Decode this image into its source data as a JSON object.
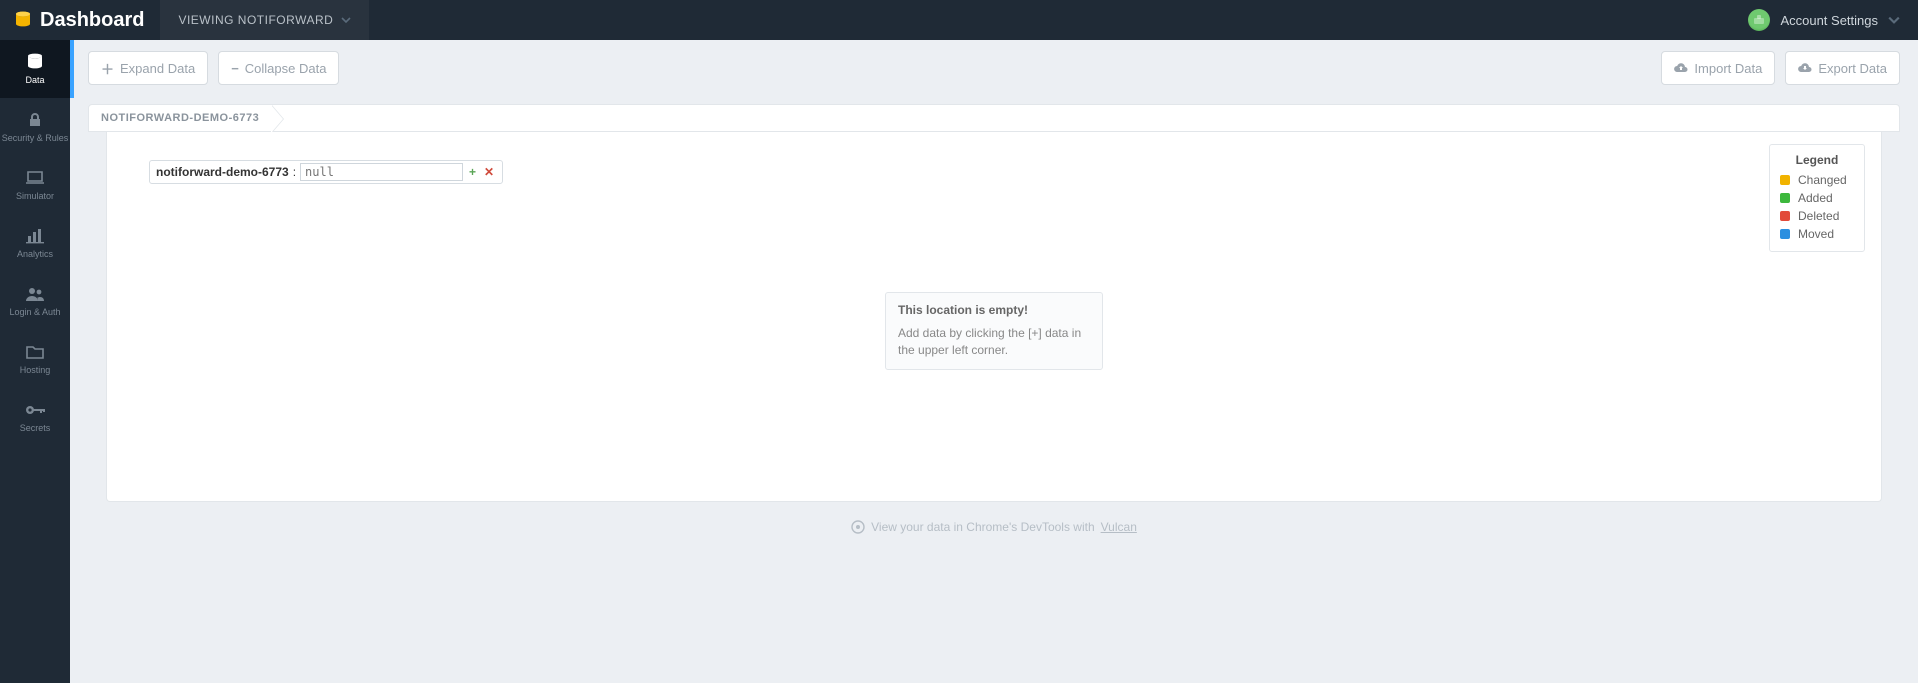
{
  "header": {
    "brand": "Dashboard",
    "viewing_label": "VIEWING NOTIFORWARD",
    "account_label": "Account Settings"
  },
  "sidebar": {
    "items": [
      {
        "id": "data",
        "label": "Data",
        "active": true
      },
      {
        "id": "security",
        "label": "Security & Rules",
        "active": false
      },
      {
        "id": "simulator",
        "label": "Simulator",
        "active": false
      },
      {
        "id": "analytics",
        "label": "Analytics",
        "active": false
      },
      {
        "id": "login",
        "label": "Login & Auth",
        "active": false
      },
      {
        "id": "hosting",
        "label": "Hosting",
        "active": false
      },
      {
        "id": "secrets",
        "label": "Secrets",
        "active": false
      }
    ]
  },
  "toolbar": {
    "expand_label": "Expand Data",
    "collapse_label": "Collapse Data",
    "import_label": "Import Data",
    "export_label": "Export Data"
  },
  "breadcrumb": {
    "root": "NOTIFORWARD-DEMO-6773"
  },
  "root_node": {
    "key": "notiforward-demo-6773",
    "value_placeholder": "null"
  },
  "legend": {
    "title": "Legend",
    "items": [
      {
        "label": "Changed",
        "color": "#f1b300"
      },
      {
        "label": "Added",
        "color": "#3db83d"
      },
      {
        "label": "Deleted",
        "color": "#e24b3a"
      },
      {
        "label": "Moved",
        "color": "#2b8fe0"
      }
    ]
  },
  "empty": {
    "title": "This location is empty!",
    "body": "Add data by clicking the [+] data in the upper left corner."
  },
  "footer": {
    "text": "View your data in Chrome's DevTools with ",
    "link": "Vulcan"
  }
}
